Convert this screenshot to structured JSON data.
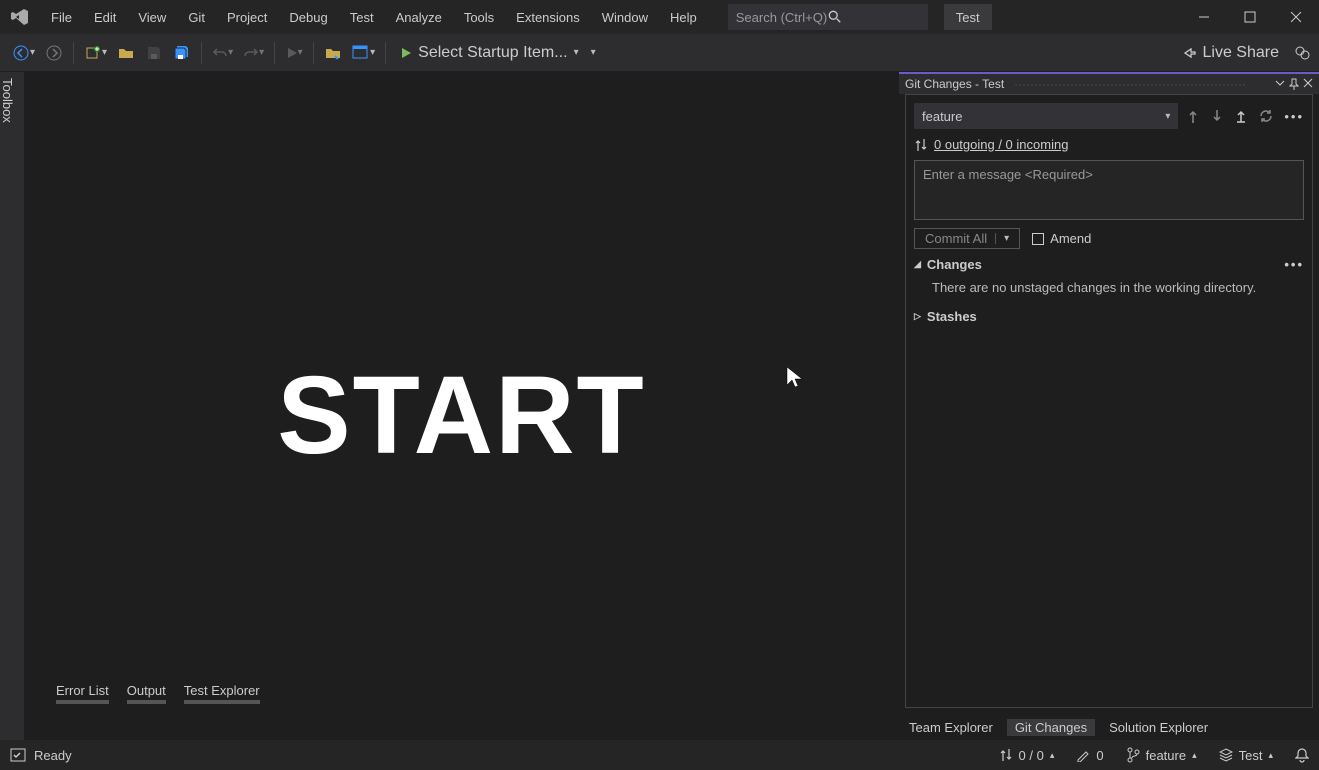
{
  "menu": {
    "file": "File",
    "edit": "Edit",
    "view": "View",
    "git": "Git",
    "project": "Project",
    "debug": "Debug",
    "test": "Test",
    "analyze": "Analyze",
    "tools": "Tools",
    "extensions": "Extensions",
    "window": "Window",
    "help": "Help"
  },
  "search": {
    "placeholder": "Search (Ctrl+Q)"
  },
  "solution_name": "Test",
  "toolbar": {
    "startup_label": "Select Startup Item...",
    "live_share": "Live Share"
  },
  "toolbox_tab": "Toolbox",
  "main_overlay": "START",
  "git_panel": {
    "title": "Git Changes - Test",
    "branch": "feature",
    "sync_status": "0 outgoing / 0 incoming",
    "commit_placeholder": "Enter a message <Required>",
    "commit_button": "Commit All",
    "amend_label": "Amend",
    "changes_heading": "Changes",
    "changes_empty": "There are no unstaged changes in the working directory.",
    "stashes_heading": "Stashes"
  },
  "panel_tabs": {
    "team_explorer": "Team Explorer",
    "git_changes": "Git Changes",
    "solution_explorer": "Solution Explorer"
  },
  "bottom_tabs": {
    "error_list": "Error List",
    "output": "Output",
    "test_explorer": "Test Explorer"
  },
  "status": {
    "ready": "Ready",
    "sync": "0 / 0",
    "pending": "0",
    "branch": "feature",
    "repo": "Test"
  }
}
